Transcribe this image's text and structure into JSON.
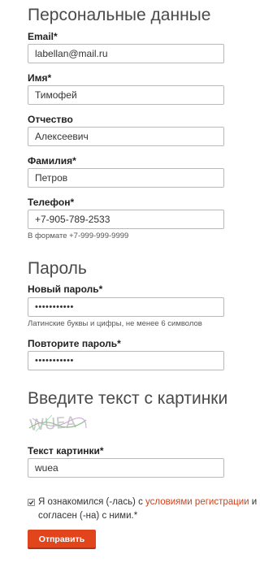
{
  "personal": {
    "title": "Персональные данные",
    "email_label": "Email*",
    "email_value": "labellan@mail.ru",
    "name_label": "Имя*",
    "name_value": "Тимофей",
    "patronymic_label": "Отчество",
    "patronymic_value": "Алексеевич",
    "surname_label": "Фамилия*",
    "surname_value": "Петров",
    "phone_label": "Телефон*",
    "phone_value": "+7-905-789-2533",
    "phone_hint": "В формате +7-999-999-9999"
  },
  "password": {
    "title": "Пароль",
    "new_label": "Новый пароль*",
    "new_value": "•••••••••••",
    "new_hint": "Латинские буквы и цифры, не менее 6 символов",
    "repeat_label": "Повторите пароль*",
    "repeat_value": "•••••••••••"
  },
  "captcha": {
    "title": "Введите текст с картинки",
    "image_text": "WUEA",
    "label": "Текст картинки*",
    "value": "wuea"
  },
  "agreement": {
    "text_before": "Я ознакомился (-лась) с ",
    "link_text": "условиями регистрации",
    "text_after": " и согласен (-на) с ними.*",
    "checked": true
  },
  "submit_label": "Отправить",
  "colors": {
    "accent": "#e2451b",
    "link": "#d2411a",
    "border": "#b9b9b9"
  }
}
